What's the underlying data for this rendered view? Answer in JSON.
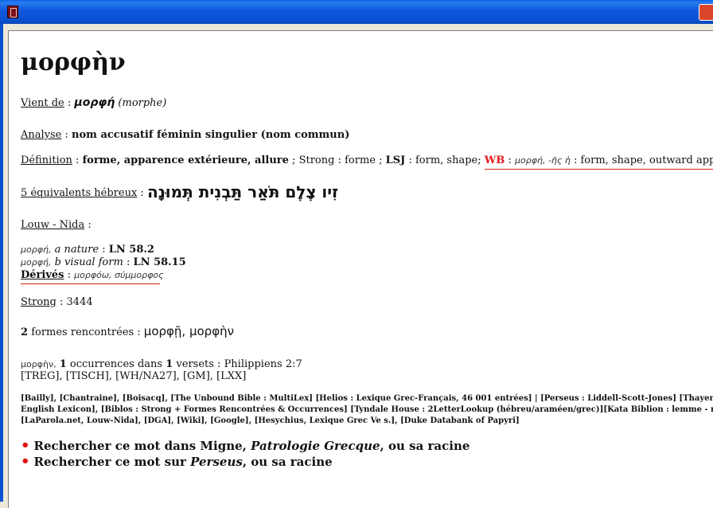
{
  "window": {
    "icon": "book-icon",
    "close_icon": "close-icon"
  },
  "entry": {
    "headword": "μορφὴν",
    "vient_de_label": "Vient de",
    "lemma": "μορφή",
    "translit": "(morphe)",
    "analyse_label": "Analyse",
    "analyse_value": "nom accusatif féminin singulier (nom commun)",
    "definition_label": "Définition",
    "definition_main": "forme, apparence extérieure, allure",
    "strong_label_def": "Strong",
    "strong_def": "forme",
    "lsj_label": "LSJ",
    "lsj_def": "form, shape;",
    "wb_label": "WB",
    "wb_greek": "μορφή, -ῆς ἡ",
    "wb_def": "form, shape, outward appearance",
    "hebrew_label": "5 équivalents hébreux",
    "hebrew_words": "זִיו צֶלֶם תֹּאַר תַּבְנִית תְּמוּנָה",
    "louw_nida_label": "Louw - Nida",
    "ln_1_greek": "μορφή,",
    "ln_1_sense": "a nature",
    "ln_1_code": "LN 58.2",
    "ln_2_greek": "μορφή,",
    "ln_2_sense": "b visual form",
    "ln_2_code": "LN 58.15",
    "derives_label": "Dérivés",
    "derives_value": "μορφόω, σύμμορφος",
    "strong_label": "Strong",
    "strong_number": "3444",
    "formes_count": "2",
    "formes_label": "formes rencontrées",
    "formes_values": "μορφῇ, μορφὴν",
    "occ_greek": "μορφὴν,",
    "occ_count": "1",
    "occ_text_1": "occurrences dans",
    "versets_count": "1",
    "occ_text_2": "versets : Philippiens 2:7",
    "editions": "[TREG], [TISCH], [WH/NA27], [GM], [LXX]",
    "refs_line_1": "[Bailly], [Chantraine], [Boisacq], [The Unbound Bible : MultiLex] [Helios : Lexique Grec-Français, 46 001 entrées] | [Perseus : Liddell-Scott-Jones] [Thayer : Greek-",
    "refs_line_2": "English Lexicon], [Biblos : Strong + Formes Rencontrées & Occurrences] [Tyndale House : 2LetterLookup (hébreu/araméen/grec)][Kata Biblion : lemme - mot],",
    "refs_line_3": "[LaParola.net, Louw-Nida], [DGA], [Wiki], [Google], [Hesychius, Lexique Grec Ve s.], [Duke Databank of Papyri]",
    "link1_pre": "Rechercher ce mot dans Migne,",
    "link1_italic": "Patrologie Grecque",
    "link1_post": ", ou sa racine",
    "link2_pre": "Rechercher ce mot sur",
    "link2_italic": "Perseus",
    "link2_post": ", ou sa racine",
    "bullet": "•",
    "sep_colon": " : ",
    "sep_semicolon": " ; "
  }
}
